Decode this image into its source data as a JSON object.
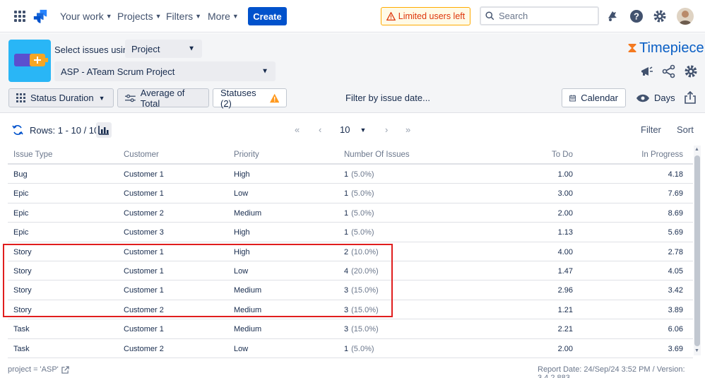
{
  "nav": {
    "items": [
      {
        "label": "Your work"
      },
      {
        "label": "Projects"
      },
      {
        "label": "Filters"
      },
      {
        "label": "More"
      }
    ],
    "create_label": "Create",
    "limited_label": "Limited users left",
    "search_placeholder": "Search"
  },
  "header": {
    "select_label": "Select issues using",
    "select_mode": "Project",
    "project_value": "ASP - ATeam Scrum Project",
    "brand": "Timepiece"
  },
  "toolbar": {
    "status_duration": "Status Duration",
    "average": "Average of Total",
    "statuses": "Statuses (2)",
    "filter_date": "Filter by issue date...",
    "calendar": "Calendar",
    "days": "Days"
  },
  "controls": {
    "rows": "Rows: 1 - 10 / 10",
    "page_size": "10",
    "filter": "Filter",
    "sort": "Sort"
  },
  "table": {
    "headers": [
      "Issue Type",
      "Customer",
      "Priority",
      "Number Of Issues",
      "To Do",
      "In Progress"
    ],
    "rows": [
      {
        "type": "Bug",
        "customer": "Customer 1",
        "priority": "High",
        "count": "1",
        "pct": "(5.0%)",
        "todo": "1.00",
        "inprog": "4.18"
      },
      {
        "type": "Epic",
        "customer": "Customer 1",
        "priority": "Low",
        "count": "1",
        "pct": "(5.0%)",
        "todo": "3.00",
        "inprog": "7.69"
      },
      {
        "type": "Epic",
        "customer": "Customer 2",
        "priority": "Medium",
        "count": "1",
        "pct": "(5.0%)",
        "todo": "2.00",
        "inprog": "8.69"
      },
      {
        "type": "Epic",
        "customer": "Customer 3",
        "priority": "High",
        "count": "1",
        "pct": "(5.0%)",
        "todo": "1.13",
        "inprog": "5.69"
      },
      {
        "type": "Story",
        "customer": "Customer 1",
        "priority": "High",
        "count": "2",
        "pct": "(10.0%)",
        "todo": "4.00",
        "inprog": "2.78"
      },
      {
        "type": "Story",
        "customer": "Customer 1",
        "priority": "Low",
        "count": "4",
        "pct": "(20.0%)",
        "todo": "1.47",
        "inprog": "4.05"
      },
      {
        "type": "Story",
        "customer": "Customer 1",
        "priority": "Medium",
        "count": "3",
        "pct": "(15.0%)",
        "todo": "2.96",
        "inprog": "3.42"
      },
      {
        "type": "Story",
        "customer": "Customer 2",
        "priority": "Medium",
        "count": "3",
        "pct": "(15.0%)",
        "todo": "1.21",
        "inprog": "3.89"
      },
      {
        "type": "Task",
        "customer": "Customer 1",
        "priority": "Medium",
        "count": "3",
        "pct": "(15.0%)",
        "todo": "2.21",
        "inprog": "6.06"
      },
      {
        "type": "Task",
        "customer": "Customer 2",
        "priority": "Low",
        "count": "1",
        "pct": "(5.0%)",
        "todo": "2.00",
        "inprog": "3.69"
      }
    ]
  },
  "footer": {
    "query": "project = 'ASP'",
    "report": "Report Date: 24/Sep/24 3:52 PM / Version: 3.4.2.883"
  },
  "colors": {
    "primary": "#0052cc",
    "highlight": "#e01e1e",
    "warning": "#de350b"
  }
}
